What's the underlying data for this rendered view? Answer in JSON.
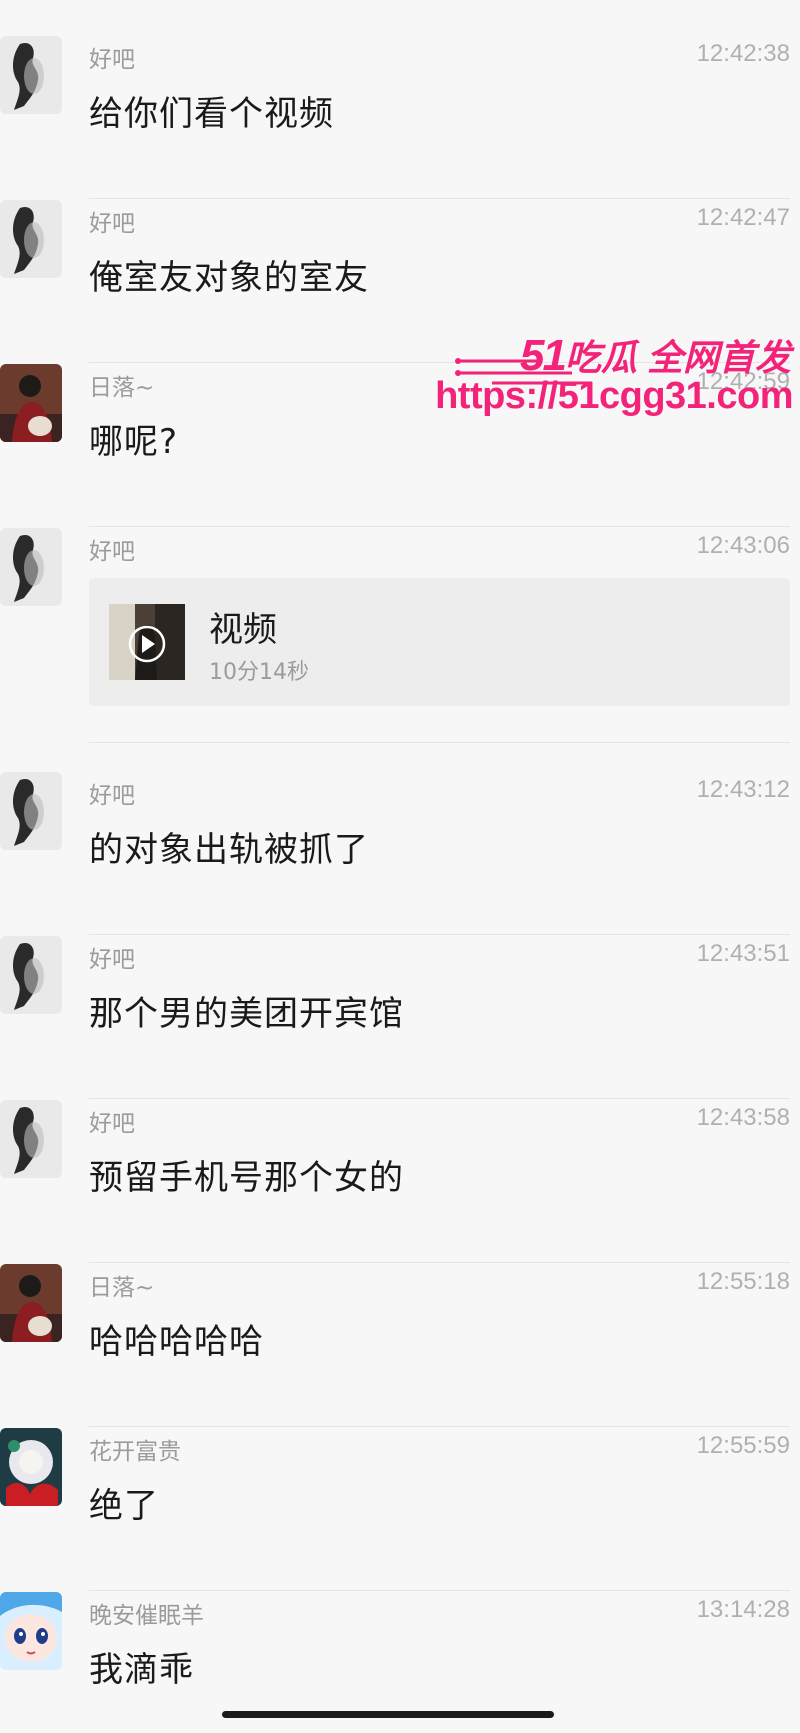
{
  "header_fragment": "···",
  "messages": [
    {
      "sender": "好吧",
      "time": "12:42:38",
      "text": "给你们看个视频"
    },
    {
      "sender": "好吧",
      "time": "12:42:47",
      "text": "俺室友对象的室友"
    },
    {
      "sender": "日落~",
      "time": "12:42:59",
      "text": "哪呢?"
    },
    {
      "sender": "好吧",
      "time": "12:43:06",
      "video_title": "视频",
      "video_duration": "10分14秒"
    },
    {
      "sender": "好吧",
      "time": "12:43:12",
      "text": "的对象出轨被抓了"
    },
    {
      "sender": "好吧",
      "time": "12:43:51",
      "text": "那个男的美团开宾馆"
    },
    {
      "sender": "好吧",
      "time": "12:43:58",
      "text": "预留手机号那个女的"
    },
    {
      "sender": "日落~",
      "time": "12:55:18",
      "text": "哈哈哈哈哈"
    },
    {
      "sender": "花开富贵",
      "time": "12:55:59",
      "text": "绝了"
    },
    {
      "sender": "晚安催眠羊",
      "time": "13:14:28",
      "text": "我滴乖"
    }
  ],
  "watermark": {
    "brand_number": "51",
    "brand_text": "吃瓜 全网首发",
    "url": "https://51cgg31.com",
    "color": "#f4237a"
  },
  "avatars": {
    "haoba": "silhouette-avatar",
    "riluo": "person-avatar",
    "huakai": "flower-avatar",
    "wanan": "anime-avatar"
  }
}
